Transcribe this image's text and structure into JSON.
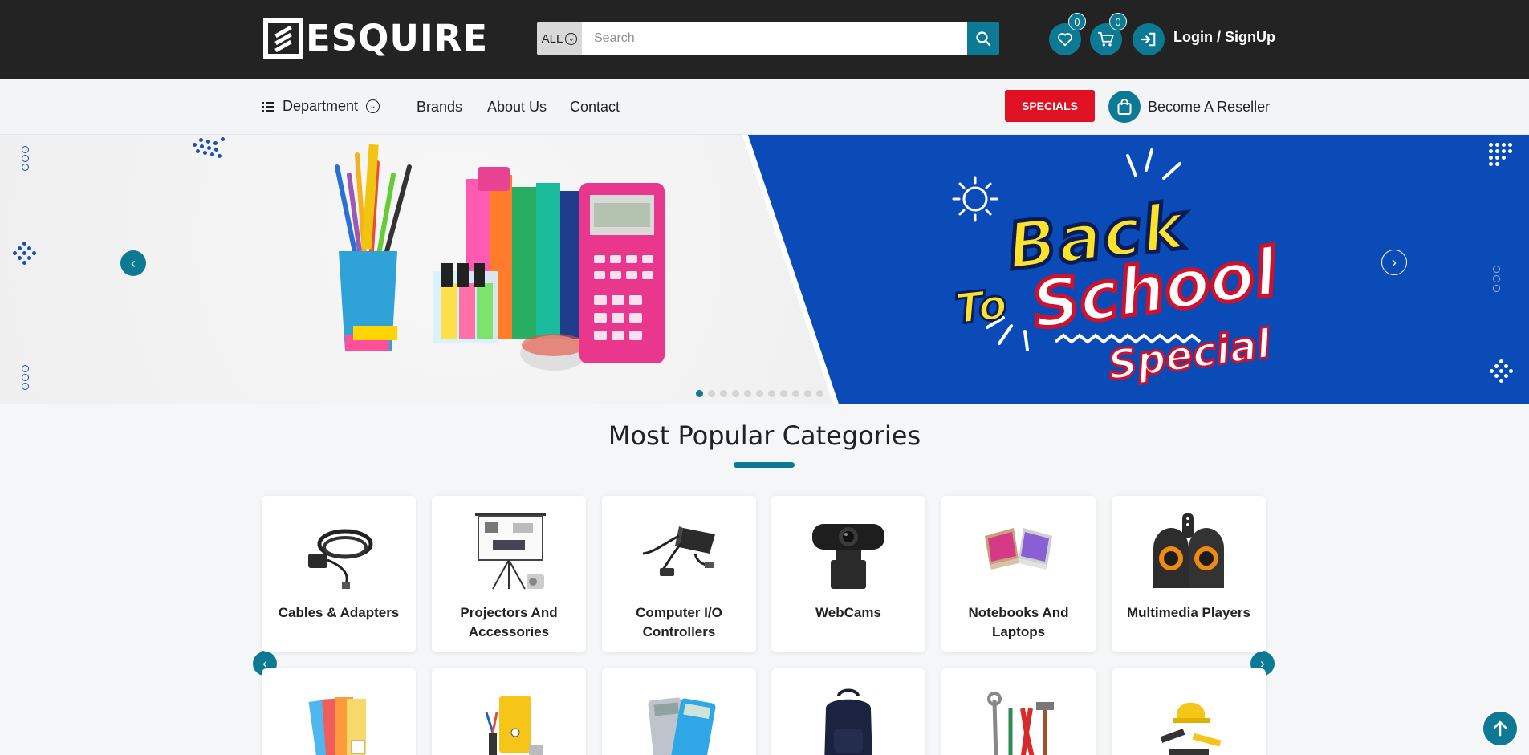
{
  "header": {
    "logo_text": "ESQUIRE",
    "search": {
      "category": "ALL",
      "placeholder": "Search"
    },
    "wishlist_count": "0",
    "cart_count": "0",
    "login_label": "Login / SignUp"
  },
  "nav": {
    "department_label": "Department",
    "links": [
      "Brands",
      "About Us",
      "Contact"
    ],
    "specials_label": "SPECIALS",
    "reseller_label": "Become A Reseller"
  },
  "hero": {
    "headline_back": "Back",
    "headline_to": "To",
    "headline_school": "School",
    "headline_special": "Special",
    "slide_count": 11,
    "active_slide": 1
  },
  "categories": {
    "title": "Most Popular Categories",
    "items": [
      {
        "label": "Cables & Adapters",
        "icon": "cable-icon"
      },
      {
        "label": "Projectors And Accessories",
        "icon": "projector-icon"
      },
      {
        "label": "Computer I/O Controllers",
        "icon": "controller-icon"
      },
      {
        "label": "WebCams",
        "icon": "webcam-icon"
      },
      {
        "label": "Notebooks And Laptops",
        "icon": "laptop-icon"
      },
      {
        "label": "Multimedia Players",
        "icon": "speaker-icon"
      }
    ],
    "row2_icons": [
      "paper-icon",
      "folder-icon",
      "calculator-icon",
      "backpack-icon",
      "tools-icon",
      "toolkit-icon"
    ]
  },
  "colors": {
    "accent": "#0c7a95",
    "header_bg": "#232323",
    "specials": "#e01122",
    "hero_blue": "#0b4bb8"
  }
}
